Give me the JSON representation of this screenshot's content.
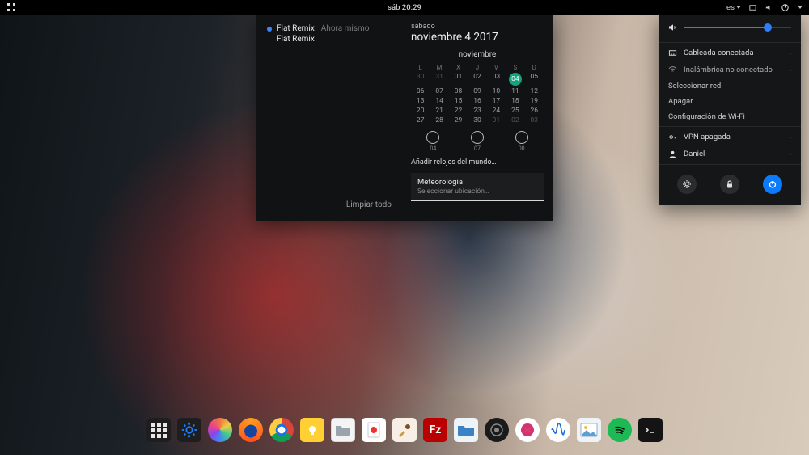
{
  "topbar": {
    "activities_icon": "activities",
    "clock": "sáb 20:29",
    "lang": "es",
    "tray": [
      "network",
      "volume",
      "power"
    ]
  },
  "calendar_popup": {
    "notifications": [
      {
        "title": "Flat Remix",
        "sub": "Ahora mismo"
      },
      {
        "title": "Flat Remix"
      }
    ],
    "clear_all": "Limpiar todo",
    "dayname": "sábado",
    "date_line": "noviembre  4 2017",
    "month": "noviembre",
    "dow": [
      "L",
      "M",
      "X",
      "J",
      "V",
      "S",
      "D"
    ],
    "prev_tail": [
      "30",
      "31"
    ],
    "days": [
      "01",
      "02",
      "03",
      "04",
      "05",
      "06",
      "07",
      "08",
      "09",
      "10",
      "11",
      "12",
      "13",
      "14",
      "15",
      "16",
      "17",
      "18",
      "19",
      "20",
      "21",
      "22",
      "23",
      "24",
      "25",
      "26",
      "27",
      "28",
      "29",
      "30"
    ],
    "next_head": [
      "01",
      "02",
      "03"
    ],
    "today": "04",
    "clock_labels": [
      "04",
      "07",
      "00"
    ],
    "add_clocks": "Añadir relojes del mundo…",
    "weather_title": "Meteorología",
    "weather_sub": "Seleccionar ubicación…"
  },
  "system_popup": {
    "volume_icon": "volume",
    "volume_pct": 78,
    "wired": "Cableada conectada",
    "wifi": "Inalámbrica no conectado",
    "select_net": "Seleccionar red",
    "power_off": "Apagar",
    "wifi_settings": "Configuración de Wi-Fi",
    "vpn": "VPN apagada",
    "user": "Daniel",
    "action_settings": "settings",
    "action_lock": "lock",
    "action_power": "power"
  },
  "dock": {
    "items": [
      {
        "name": "apps-grid",
        "label": "Show Applications"
      },
      {
        "name": "settings",
        "label": "Settings"
      },
      {
        "name": "color",
        "label": "Color"
      },
      {
        "name": "firefox",
        "label": "Firefox"
      },
      {
        "name": "chrome",
        "label": "Chrome"
      },
      {
        "name": "notes",
        "label": "Notes"
      },
      {
        "name": "files",
        "label": "Files"
      },
      {
        "name": "docs",
        "label": "Documents"
      },
      {
        "name": "builder",
        "label": "Builder"
      },
      {
        "name": "filezilla",
        "label": "FileZilla"
      },
      {
        "name": "nautilus",
        "label": "File Manager"
      },
      {
        "name": "obs",
        "label": "OBS"
      },
      {
        "name": "lollypop",
        "label": "Lollypop"
      },
      {
        "name": "audacity",
        "label": "Audio"
      },
      {
        "name": "gallery",
        "label": "Gallery"
      },
      {
        "name": "spotify",
        "label": "Spotify"
      },
      {
        "name": "terminal",
        "label": "Terminal"
      }
    ]
  }
}
